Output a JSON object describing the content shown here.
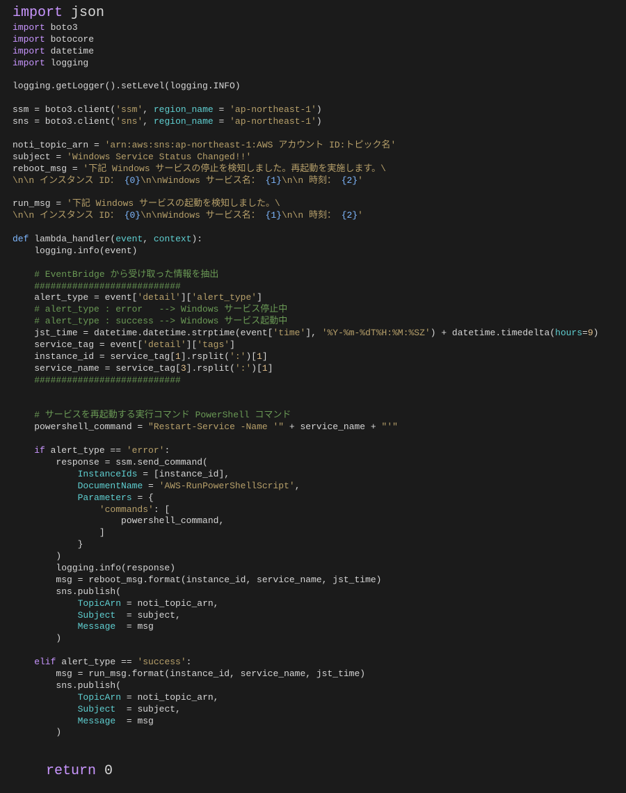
{
  "code": {
    "l01a": "import",
    "l01b": " json",
    "l02a": "import",
    "l02b": " boto3",
    "l03a": "import",
    "l03b": " botocore",
    "l04a": "import",
    "l04b": " datetime",
    "l05a": "import",
    "l05b": " logging",
    "l07": "logging.getLogger().setLevel(logging.INFO)",
    "l09": "ssm = boto3.client(",
    "l09s1": "'ssm'",
    "l09b": ", ",
    "l09p": "region_name",
    "l09c": " = ",
    "l09s2": "'ap-northeast-1'",
    "l09d": ")",
    "l10": "sns = boto3.client(",
    "l10s1": "'sns'",
    "l10b": ", ",
    "l10p": "region_name",
    "l10c": " = ",
    "l10s2": "'ap-northeast-1'",
    "l10d": ")",
    "l12": "noti_topic_arn = ",
    "l12s": "'arn:aws:sns:ap-northeast-1:AWS アカウント ID:トピック名'",
    "l13": "subject = ",
    "l13s": "'Windows Service Status Changed!!'",
    "l14": "reboot_msg = ",
    "l14s": "'下記 Windows サービスの停止を検知しました。再起動を実施します。\\",
    "l15": "\\n\\n インスタンス ID： ",
    "l15a": "{0}",
    "l15b": "\\n\\nWindows サービス名： ",
    "l15c": "{1}",
    "l15d": "\\n\\n 時刻： ",
    "l15e": "{2}",
    "l15f": "'",
    "l17": "run_msg = ",
    "l17s": "'下記 Windows サービスの起動を検知しました。\\",
    "l18": "\\n\\n インスタンス ID： ",
    "l18a": "{0}",
    "l18b": "\\n\\nWindows サービス名： ",
    "l18c": "{1}",
    "l18d": "\\n\\n 時刻： ",
    "l18e": "{2}",
    "l18f": "'",
    "l20a": "def",
    "l20b": " lambda_handler(",
    "l20c": "event",
    "l20d": ", ",
    "l20e": "context",
    "l20f": "):",
    "l21": "    logging.info(event)",
    "l23": "    # EventBridge から受け取った情報を抽出",
    "l24": "    ###########################",
    "l25": "    alert_type = event[",
    "l25s1": "'detail'",
    "l25b": "][",
    "l25s2": "'alert_type'",
    "l25c": "]",
    "l26": "    # alert_type : error   --> Windows サービス停止中",
    "l27": "    # alert_type : success --> Windows サービス起動中",
    "l28": "    jst_time = datetime.datetime.strptime(event[",
    "l28s1": "'time'",
    "l28b": "], ",
    "l28s2": "'%Y-%m-%dT%H:%M:%SZ'",
    "l28c": ") + datetime.timedelta(",
    "l28p": "hours",
    "l28d": "=",
    "l28n": "9",
    "l28e": ")",
    "l29": "    service_tag = event[",
    "l29s1": "'detail'",
    "l29b": "][",
    "l29s2": "'tags'",
    "l29c": "]",
    "l30": "    instance_id = service_tag[",
    "l30n": "1",
    "l30b": "].rsplit(",
    "l30s": "':'",
    "l30c": ")[",
    "l30n2": "1",
    "l30d": "]",
    "l31": "    service_name = service_tag[",
    "l31n": "3",
    "l31b": "].rsplit(",
    "l31s": "':'",
    "l31c": ")[",
    "l31n2": "1",
    "l31d": "]",
    "l32": "    ###########################",
    "l35": "    # サービスを再起動する実行コマンド PowerShell コマンド",
    "l36": "    powershell_command = ",
    "l36s1": "\"Restart-Service -Name '\"",
    "l36b": " + service_name + ",
    "l36s2": "\"'\"",
    "l38a": "    if",
    "l38b": " alert_type == ",
    "l38s": "'error'",
    "l38c": ":",
    "l39": "        response = ssm.send_command(",
    "l40a": "            ",
    "l40p": "InstanceIds",
    "l40b": " = [instance_id],",
    "l41a": "            ",
    "l41p": "DocumentName",
    "l41b": " = ",
    "l41s": "'AWS-RunPowerShellScript'",
    "l41c": ",",
    "l42a": "            ",
    "l42p": "Parameters",
    "l42b": " = {",
    "l43a": "                ",
    "l43s": "'commands'",
    "l43b": ": [",
    "l44": "                    powershell_command,",
    "l45": "                ]",
    "l46": "            }",
    "l47": "        )",
    "l48": "        logging.info(response)",
    "l49": "        msg = reboot_msg.format(instance_id, service_name, jst_time)",
    "l50": "        sns.publish(",
    "l51a": "            ",
    "l51p": "TopicArn",
    "l51b": " = noti_topic_arn,",
    "l52a": "            ",
    "l52p": "Subject",
    "l52b": "  = subject,",
    "l53a": "            ",
    "l53p": "Message",
    "l53b": "  = msg",
    "l54": "        )",
    "l56a": "    elif",
    "l56b": " alert_type == ",
    "l56s": "'success'",
    "l56c": ":",
    "l57": "        msg = run_msg.format(instance_id, service_name, jst_time)",
    "l58": "        sns.publish(",
    "l59a": "            ",
    "l59p": "TopicArn",
    "l59b": " = noti_topic_arn,",
    "l60a": "            ",
    "l60p": "Subject",
    "l60b": "  = subject,",
    "l61a": "            ",
    "l61p": "Message",
    "l61b": "  = msg",
    "l62": "        )",
    "l65a": "    return",
    "l65b": " 0"
  }
}
